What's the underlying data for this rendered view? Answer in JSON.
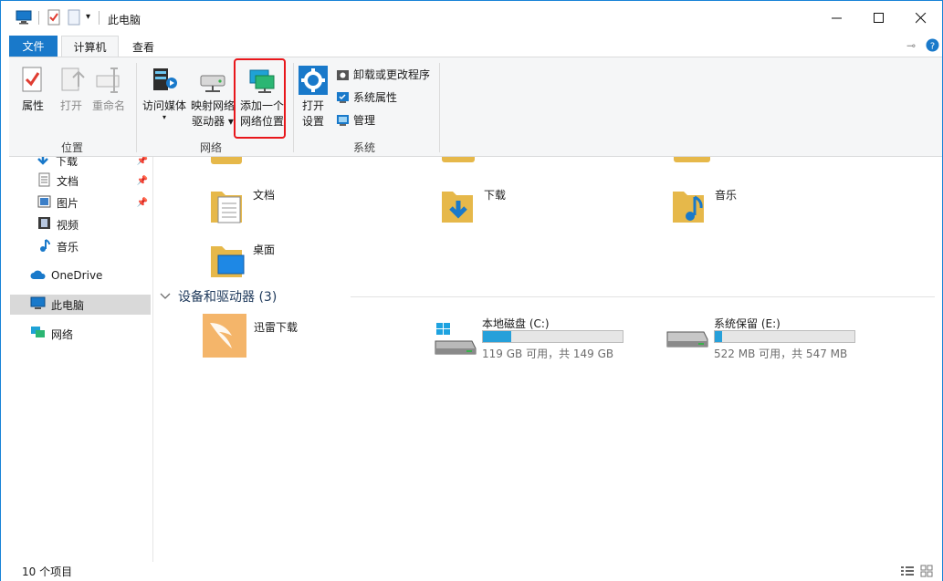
{
  "window": {
    "title": "此电脑"
  },
  "tabs": {
    "file": "文件",
    "computer": "计算机",
    "view": "查看"
  },
  "ribbon": {
    "properties": "属性",
    "open": "打开",
    "rename": "重命名",
    "group_location": "位置",
    "access_media": "访问媒体",
    "map_drive_line1": "映射网络",
    "map_drive_line2": "驱动器 ▾",
    "add_network_line1": "添加一个",
    "add_network_line2": "网络位置",
    "group_network": "网络",
    "open_settings_line1": "打开",
    "open_settings_line2": "设置",
    "uninstall": "卸载或更改程序",
    "system_properties": "系统属性",
    "manage": "管理",
    "group_system": "系统"
  },
  "nav": {
    "downloads": "下载",
    "documents": "文档",
    "pictures": "图片",
    "videos": "视频",
    "music": "音乐",
    "onedrive": "OneDrive",
    "this_pc": "此电脑",
    "network": "网络"
  },
  "folders": {
    "documents": "文档",
    "downloads": "下载",
    "music": "音乐",
    "desktop": "桌面"
  },
  "devices": {
    "header": "设备和驱动器 (3)",
    "xunlei": "迅雷下载",
    "drive_c": {
      "name": "本地磁盘 (C:)",
      "free": "119 GB 可用，共 149 GB",
      "used_fraction": 0.2
    },
    "drive_e": {
      "name": "系统保留 (E:)",
      "free": "522 MB 可用，共 547 MB",
      "used_fraction": 0.05
    }
  },
  "status": {
    "count": "10 个项目"
  },
  "colors": {
    "accent": "#1979ca",
    "highlight": "#e8171b",
    "drive_fill": "#26a0da"
  }
}
